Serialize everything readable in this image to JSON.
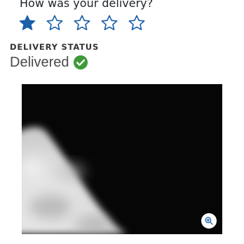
{
  "rating": {
    "question": "How was your delivery?",
    "max_stars": 5,
    "selected_stars": 1,
    "star_color": "#1a5fa8"
  },
  "delivery_status": {
    "label": "DELIVERY STATUS",
    "value": "Delivered",
    "check_color": "#3f9a3a"
  },
  "photo": {
    "zoom_icon": "zoom-in-icon",
    "zoom_icon_color": "#1a5fa8"
  }
}
